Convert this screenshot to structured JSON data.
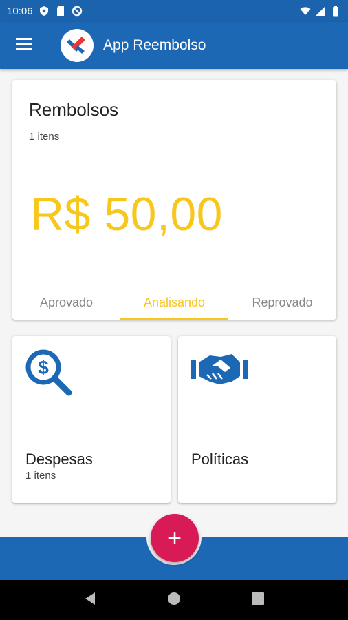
{
  "status_bar": {
    "time": "10:06"
  },
  "app_bar": {
    "title": "App Reembolso"
  },
  "summary": {
    "title": "Rembolsos",
    "count": "1 itens",
    "amount": "R$ 50,00",
    "tabs": [
      {
        "label": "Aprovado",
        "active": false
      },
      {
        "label": "Analisando",
        "active": true
      },
      {
        "label": "Reprovado",
        "active": false
      }
    ]
  },
  "cards": {
    "despesas": {
      "label": "Despesas",
      "count": "1 itens",
      "icon": "dollar-search-icon"
    },
    "politicas": {
      "label": "Políticas",
      "icon": "handshake-icon"
    }
  },
  "fab": {
    "label": "+"
  },
  "colors": {
    "primary": "#1d68b5",
    "accent": "#f7c71e",
    "fab": "#d81b57"
  }
}
